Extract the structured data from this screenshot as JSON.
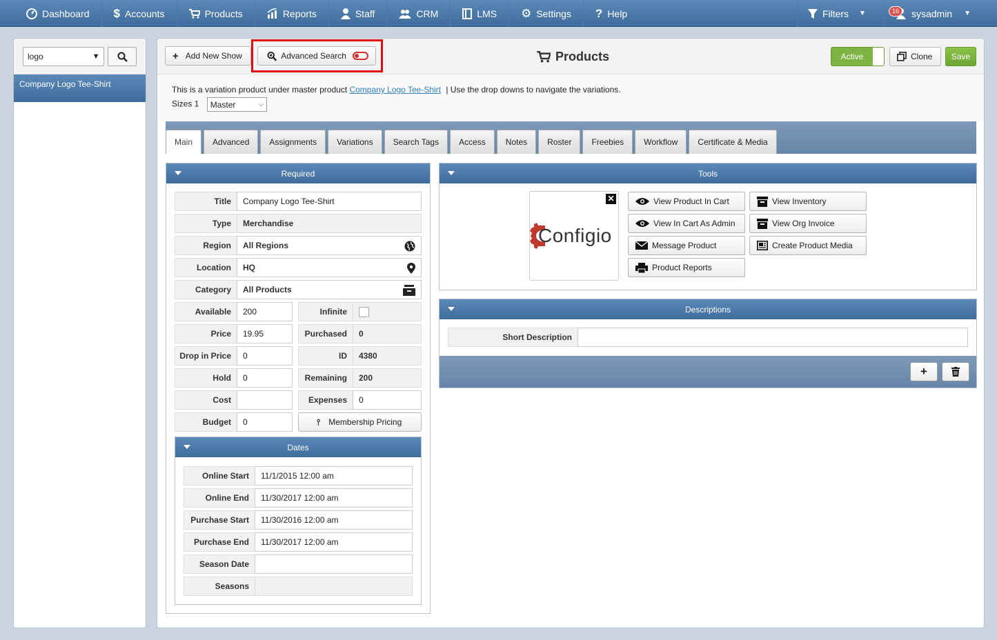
{
  "nav": {
    "items": [
      {
        "label": "Dashboard",
        "icon": "dashboard-icon"
      },
      {
        "label": "Accounts",
        "icon": "dollar-icon"
      },
      {
        "label": "Products",
        "icon": "cart-icon"
      },
      {
        "label": "Reports",
        "icon": "chart-icon"
      },
      {
        "label": "Staff",
        "icon": "user-icon"
      },
      {
        "label": "CRM",
        "icon": "users-icon"
      },
      {
        "label": "LMS",
        "icon": "book-icon"
      },
      {
        "label": "Settings",
        "icon": "gear-icon"
      },
      {
        "label": "Help",
        "icon": "question-icon"
      }
    ],
    "filters": "Filters",
    "user": "sysadmin",
    "notification_count": "16"
  },
  "sidebar": {
    "search_value": "logo",
    "items": [
      "Company Logo Tee-Shirt"
    ]
  },
  "header": {
    "add_new_show": "Add New Show",
    "advanced_search": "Advanced Search",
    "title": "Products",
    "active": "Active",
    "clone": "Clone",
    "save": "Save"
  },
  "info": {
    "prefix": "This is a variation product under master product",
    "link": "Company Logo Tee-Shirt",
    "suffix": "|  Use the drop downs to navigate the variations.",
    "sizes_label": "Sizes 1",
    "sizes_value": "Master"
  },
  "tabs": [
    "Main",
    "Advanced",
    "Assignments",
    "Variations",
    "Search Tags",
    "Access",
    "Notes",
    "Roster",
    "Freebies",
    "Workflow",
    "Certificate & Media"
  ],
  "required": {
    "title": "Required",
    "fields": {
      "title_label": "Title",
      "title_value": "Company Logo Tee-Shirt",
      "type_label": "Type",
      "type_value": "Merchandise",
      "region_label": "Region",
      "region_value": "All Regions",
      "location_label": "Location",
      "location_value": "HQ",
      "category_label": "Category",
      "category_value": "All Products",
      "available_label": "Available",
      "available_value": "200",
      "infinite_label": "Infinite",
      "price_label": "Price",
      "price_value": "19.95",
      "purchased_label": "Purchased",
      "purchased_value": "0",
      "drop_label": "Drop in Price",
      "drop_value": "0",
      "id_label": "ID",
      "id_value": "4380",
      "hold_label": "Hold",
      "hold_value": "0",
      "remaining_label": "Remaining",
      "remaining_value": "200",
      "cost_label": "Cost",
      "cost_value": "",
      "expenses_label": "Expenses",
      "expenses_value": "0",
      "budget_label": "Budget",
      "budget_value": "0",
      "membership_pricing": "Membership Pricing"
    }
  },
  "dates": {
    "title": "Dates",
    "online_start_label": "Online Start",
    "online_start_value": "11/1/2015 12:00 am",
    "online_end_label": "Online End",
    "online_end_value": "11/30/2017 12:00 am",
    "purchase_start_label": "Purchase Start",
    "purchase_start_value": "11/30/2016 12:00 am",
    "purchase_end_label": "Purchase End",
    "purchase_end_value": "11/30/2017 12:00 am",
    "season_date_label": "Season Date",
    "season_date_value": "",
    "seasons_label": "Seasons",
    "seasons_value": ""
  },
  "tools": {
    "title": "Tools",
    "logo_text": "Configio",
    "view_product_in_cart": "View Product In Cart",
    "view_inventory": "View Inventory",
    "view_in_cart_as_admin": "View In Cart As Admin",
    "view_org_invoice": "View Org Invoice",
    "message_product": "Message Product",
    "create_product_media": "Create Product Media",
    "product_reports": "Product Reports"
  },
  "descriptions": {
    "title": "Descriptions",
    "short_label": "Short Description",
    "short_value": ""
  },
  "colors": {
    "nav_blue": "#4a78a8",
    "active_green": "#7cb342",
    "highlight_red": "#e01010",
    "logo_red": "#c0392b"
  }
}
